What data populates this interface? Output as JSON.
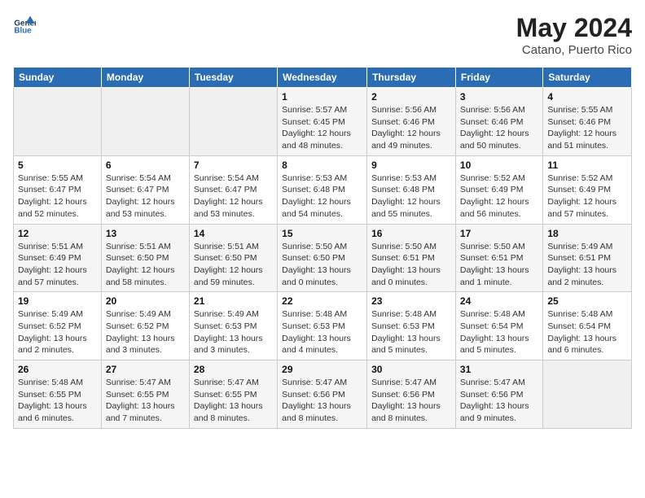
{
  "header": {
    "logo_line1": "General",
    "logo_line2": "Blue",
    "month_title": "May 2024",
    "subtitle": "Catano, Puerto Rico"
  },
  "weekdays": [
    "Sunday",
    "Monday",
    "Tuesday",
    "Wednesday",
    "Thursday",
    "Friday",
    "Saturday"
  ],
  "weeks": [
    [
      {
        "day": "",
        "info": ""
      },
      {
        "day": "",
        "info": ""
      },
      {
        "day": "",
        "info": ""
      },
      {
        "day": "1",
        "info": "Sunrise: 5:57 AM\nSunset: 6:45 PM\nDaylight: 12 hours\nand 48 minutes."
      },
      {
        "day": "2",
        "info": "Sunrise: 5:56 AM\nSunset: 6:46 PM\nDaylight: 12 hours\nand 49 minutes."
      },
      {
        "day": "3",
        "info": "Sunrise: 5:56 AM\nSunset: 6:46 PM\nDaylight: 12 hours\nand 50 minutes."
      },
      {
        "day": "4",
        "info": "Sunrise: 5:55 AM\nSunset: 6:46 PM\nDaylight: 12 hours\nand 51 minutes."
      }
    ],
    [
      {
        "day": "5",
        "info": "Sunrise: 5:55 AM\nSunset: 6:47 PM\nDaylight: 12 hours\nand 52 minutes."
      },
      {
        "day": "6",
        "info": "Sunrise: 5:54 AM\nSunset: 6:47 PM\nDaylight: 12 hours\nand 53 minutes."
      },
      {
        "day": "7",
        "info": "Sunrise: 5:54 AM\nSunset: 6:47 PM\nDaylight: 12 hours\nand 53 minutes."
      },
      {
        "day": "8",
        "info": "Sunrise: 5:53 AM\nSunset: 6:48 PM\nDaylight: 12 hours\nand 54 minutes."
      },
      {
        "day": "9",
        "info": "Sunrise: 5:53 AM\nSunset: 6:48 PM\nDaylight: 12 hours\nand 55 minutes."
      },
      {
        "day": "10",
        "info": "Sunrise: 5:52 AM\nSunset: 6:49 PM\nDaylight: 12 hours\nand 56 minutes."
      },
      {
        "day": "11",
        "info": "Sunrise: 5:52 AM\nSunset: 6:49 PM\nDaylight: 12 hours\nand 57 minutes."
      }
    ],
    [
      {
        "day": "12",
        "info": "Sunrise: 5:51 AM\nSunset: 6:49 PM\nDaylight: 12 hours\nand 57 minutes."
      },
      {
        "day": "13",
        "info": "Sunrise: 5:51 AM\nSunset: 6:50 PM\nDaylight: 12 hours\nand 58 minutes."
      },
      {
        "day": "14",
        "info": "Sunrise: 5:51 AM\nSunset: 6:50 PM\nDaylight: 12 hours\nand 59 minutes."
      },
      {
        "day": "15",
        "info": "Sunrise: 5:50 AM\nSunset: 6:50 PM\nDaylight: 13 hours\nand 0 minutes."
      },
      {
        "day": "16",
        "info": "Sunrise: 5:50 AM\nSunset: 6:51 PM\nDaylight: 13 hours\nand 0 minutes."
      },
      {
        "day": "17",
        "info": "Sunrise: 5:50 AM\nSunset: 6:51 PM\nDaylight: 13 hours\nand 1 minute."
      },
      {
        "day": "18",
        "info": "Sunrise: 5:49 AM\nSunset: 6:51 PM\nDaylight: 13 hours\nand 2 minutes."
      }
    ],
    [
      {
        "day": "19",
        "info": "Sunrise: 5:49 AM\nSunset: 6:52 PM\nDaylight: 13 hours\nand 2 minutes."
      },
      {
        "day": "20",
        "info": "Sunrise: 5:49 AM\nSunset: 6:52 PM\nDaylight: 13 hours\nand 3 minutes."
      },
      {
        "day": "21",
        "info": "Sunrise: 5:49 AM\nSunset: 6:53 PM\nDaylight: 13 hours\nand 3 minutes."
      },
      {
        "day": "22",
        "info": "Sunrise: 5:48 AM\nSunset: 6:53 PM\nDaylight: 13 hours\nand 4 minutes."
      },
      {
        "day": "23",
        "info": "Sunrise: 5:48 AM\nSunset: 6:53 PM\nDaylight: 13 hours\nand 5 minutes."
      },
      {
        "day": "24",
        "info": "Sunrise: 5:48 AM\nSunset: 6:54 PM\nDaylight: 13 hours\nand 5 minutes."
      },
      {
        "day": "25",
        "info": "Sunrise: 5:48 AM\nSunset: 6:54 PM\nDaylight: 13 hours\nand 6 minutes."
      }
    ],
    [
      {
        "day": "26",
        "info": "Sunrise: 5:48 AM\nSunset: 6:55 PM\nDaylight: 13 hours\nand 6 minutes."
      },
      {
        "day": "27",
        "info": "Sunrise: 5:47 AM\nSunset: 6:55 PM\nDaylight: 13 hours\nand 7 minutes."
      },
      {
        "day": "28",
        "info": "Sunrise: 5:47 AM\nSunset: 6:55 PM\nDaylight: 13 hours\nand 8 minutes."
      },
      {
        "day": "29",
        "info": "Sunrise: 5:47 AM\nSunset: 6:56 PM\nDaylight: 13 hours\nand 8 minutes."
      },
      {
        "day": "30",
        "info": "Sunrise: 5:47 AM\nSunset: 6:56 PM\nDaylight: 13 hours\nand 8 minutes."
      },
      {
        "day": "31",
        "info": "Sunrise: 5:47 AM\nSunset: 6:56 PM\nDaylight: 13 hours\nand 9 minutes."
      },
      {
        "day": "",
        "info": ""
      }
    ]
  ]
}
